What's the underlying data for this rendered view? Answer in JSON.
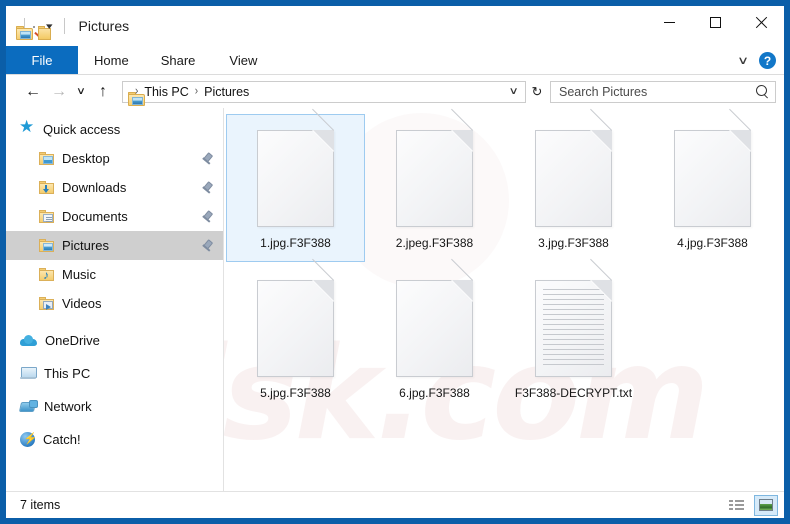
{
  "window": {
    "title": "Pictures",
    "frame_color": "#0b5ea8",
    "quick_access_toolbar": [
      {
        "name": "pictures-folder-icon"
      },
      {
        "name": "properties-icon"
      },
      {
        "name": "new-folder-icon"
      },
      {
        "name": "customize-qat-chevron"
      }
    ],
    "controls": {
      "minimize": "–",
      "maximize": "□",
      "close": "✕"
    }
  },
  "ribbon": {
    "tabs": [
      {
        "label": "File",
        "active": true
      },
      {
        "label": "Home",
        "active": false
      },
      {
        "label": "Share",
        "active": false
      },
      {
        "label": "View",
        "active": false
      }
    ],
    "collapse_chevron": "∨",
    "help_label": "?"
  },
  "navbar": {
    "back": "←",
    "forward": "→",
    "recent": "∨",
    "up": "↑",
    "breadcrumbs": [
      "This PC",
      "Pictures"
    ],
    "separator": "›",
    "address_chevron": "∨",
    "refresh": "↻"
  },
  "search": {
    "placeholder": "Search Pictures",
    "icon": "search-icon"
  },
  "sidebar": {
    "items": [
      {
        "label": "Quick access",
        "icon": "star-icon",
        "indent": false,
        "pinned": false,
        "selected": false
      },
      {
        "label": "Desktop",
        "icon": "desktop-folder-icon",
        "indent": true,
        "pinned": true,
        "selected": false
      },
      {
        "label": "Downloads",
        "icon": "downloads-folder-icon",
        "indent": true,
        "pinned": true,
        "selected": false
      },
      {
        "label": "Documents",
        "icon": "documents-folder-icon",
        "indent": true,
        "pinned": true,
        "selected": false
      },
      {
        "label": "Pictures",
        "icon": "pictures-folder-icon",
        "indent": true,
        "pinned": true,
        "selected": true
      },
      {
        "label": "Music",
        "icon": "music-folder-icon",
        "indent": true,
        "pinned": false,
        "selected": false
      },
      {
        "label": "Videos",
        "icon": "videos-folder-icon",
        "indent": true,
        "pinned": false,
        "selected": false
      },
      {
        "label": "OneDrive",
        "icon": "cloud-icon",
        "indent": false,
        "pinned": false,
        "selected": false
      },
      {
        "label": "This PC",
        "icon": "computer-icon",
        "indent": false,
        "pinned": false,
        "selected": false
      },
      {
        "label": "Network",
        "icon": "network-icon",
        "indent": false,
        "pinned": false,
        "selected": false
      },
      {
        "label": "Catch!",
        "icon": "catch-app-icon",
        "indent": false,
        "pinned": false,
        "selected": false
      }
    ],
    "selection_color": "#cfcfcf"
  },
  "files": [
    {
      "name": "1.jpg.F3F388",
      "type": "blank-document",
      "selected": true
    },
    {
      "name": "2.jpeg.F3F388",
      "type": "blank-document",
      "selected": false
    },
    {
      "name": "3.jpg.F3F388",
      "type": "blank-document",
      "selected": false
    },
    {
      "name": "4.jpg.F3F388",
      "type": "blank-document",
      "selected": false
    },
    {
      "name": "5.jpg.F3F388",
      "type": "blank-document",
      "selected": false
    },
    {
      "name": "6.jpg.F3F388",
      "type": "blank-document",
      "selected": false
    },
    {
      "name": "F3F388-DECRYPT.txt",
      "type": "text-document",
      "selected": false
    }
  ],
  "watermark": {
    "text": "isk.com"
  },
  "statusbar": {
    "items_count": "7 items",
    "views": [
      {
        "name": "details-view",
        "active": false
      },
      {
        "name": "large-icons-view",
        "active": true
      }
    ]
  }
}
